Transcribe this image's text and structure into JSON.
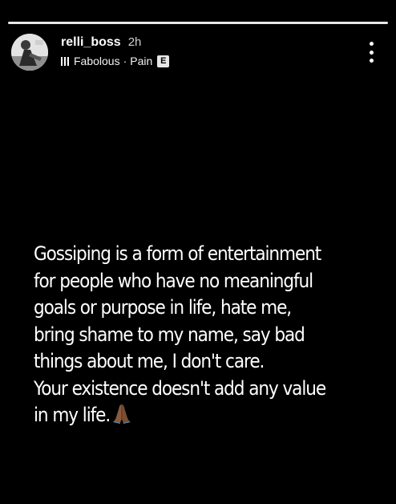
{
  "story": {
    "progress_fraction": 1.0
  },
  "header": {
    "username": "relli_boss",
    "time": "2h",
    "music": {
      "artist": "Fabolous",
      "separator": "·",
      "song": "Pain",
      "explicit_badge": "E"
    },
    "icons": {
      "avatar": "profile-avatar",
      "music": "music-bars-icon",
      "more": "more-vertical-icon"
    }
  },
  "caption": {
    "lines": [
      "Gossiping is a form of entertainment",
      "for people who have no meaningful",
      "goals or purpose in life, hate me,",
      "bring shame to my name, say bad",
      "things about me, I don't care.",
      "Your existence doesn't add any value",
      "in my life."
    ],
    "emoji": "praying-hands-icon"
  },
  "colors": {
    "background": "#000000",
    "text": "#ffffff",
    "progress_bar": "#e8e8e8",
    "emoji_skin": "#8a5a3c"
  }
}
